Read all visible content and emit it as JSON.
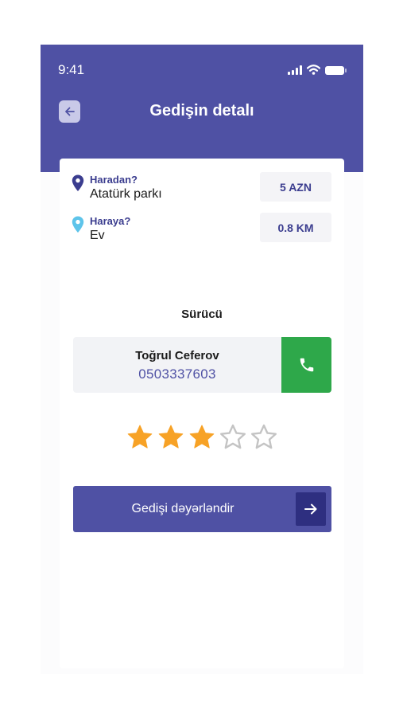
{
  "status_bar": {
    "time": "9:41"
  },
  "header": {
    "title": "Gedişin detalı"
  },
  "trip": {
    "from_label": "Haradan?",
    "from_value": "Atatürk parkı",
    "to_label": "Haraya?",
    "to_value": "Ev",
    "price": "5 AZN",
    "distance": "0.8 KM"
  },
  "driver": {
    "heading": "Sürücü",
    "name": "Toğrul Ceferov",
    "phone": "0503337603"
  },
  "rating": {
    "value": 3,
    "max": 5
  },
  "actions": {
    "rate_label": "Gedişi dəyərləndir"
  },
  "colors": {
    "primary": "#4f51a4",
    "primary_dark": "#2e2f80",
    "call_green": "#2ea84a",
    "star_filled": "#f7a226",
    "star_empty": "#c4c4c4",
    "pin_from": "#3b3d8f",
    "pin_to": "#5ec4ea"
  }
}
